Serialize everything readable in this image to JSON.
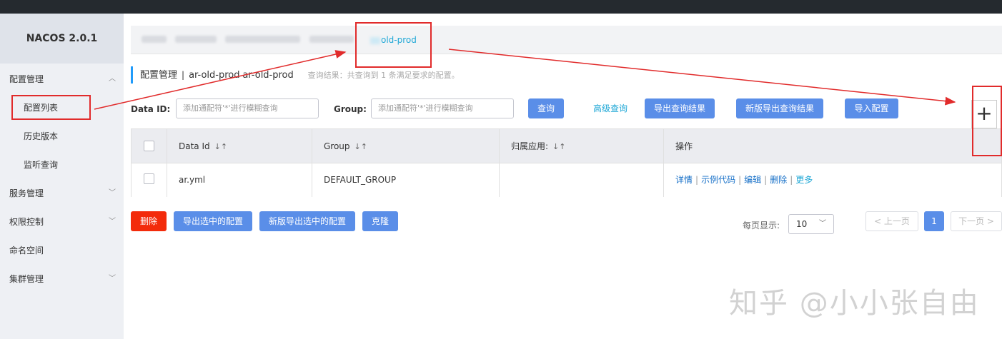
{
  "app": {
    "logo": "NACOS 2.0.1"
  },
  "sidebar": {
    "items": [
      {
        "label": "配置管理",
        "chevron": "︿"
      },
      {
        "label": "配置列表"
      },
      {
        "label": "历史版本"
      },
      {
        "label": "监听查询"
      },
      {
        "label": "服务管理",
        "chevron": "﹀"
      },
      {
        "label": "权限控制",
        "chevron": "﹀"
      },
      {
        "label": "命名空间"
      },
      {
        "label": "集群管理",
        "chevron": "﹀"
      }
    ]
  },
  "namespace_bar": {
    "active_label": "old-prod"
  },
  "header": {
    "title": "配置管理",
    "separator": "|",
    "namespace": "ar-old-prod",
    "namespace_id": "ar-old-prod",
    "hint": "查询结果：共查询到 1 条满足要求的配置。"
  },
  "filters": {
    "data_id_label": "Data ID:",
    "data_id_placeholder": "添加通配符'*'进行模糊查询",
    "group_label": "Group:",
    "group_placeholder": "添加通配符'*'进行模糊查询",
    "query_button": "查询",
    "advanced_link": "高级查询",
    "export_button": "导出查询结果",
    "new_export_button": "新版导出查询结果",
    "import_button": "导入配置",
    "add_button": "+"
  },
  "table": {
    "columns": [
      "Data Id",
      "Group",
      "归属应用:",
      "操作"
    ],
    "sort_icon": "↓↑",
    "rows": [
      {
        "data_id": "ar.yml",
        "group": "DEFAULT_GROUP",
        "app": "",
        "actions": [
          "详情",
          "示例代码",
          "编辑",
          "删除",
          "更多"
        ]
      }
    ]
  },
  "bulk_actions": {
    "delete": "删除",
    "export_selected": "导出选中的配置",
    "new_export_selected": "新版导出选中的配置",
    "clone": "克隆"
  },
  "pagination": {
    "page_size_label": "每页显示:",
    "page_size": "10",
    "prev": "< 上一页",
    "current": "1",
    "next": "下一页 >"
  },
  "watermark": "知乎 @小小张自由",
  "colors": {
    "topbar": "#252a2f",
    "sidebar_bg": "#eef0f4",
    "primary": "#5a8ee8",
    "danger": "#f32b0b",
    "link": "#1ea7d6",
    "annotation_red": "#e12b2b"
  }
}
